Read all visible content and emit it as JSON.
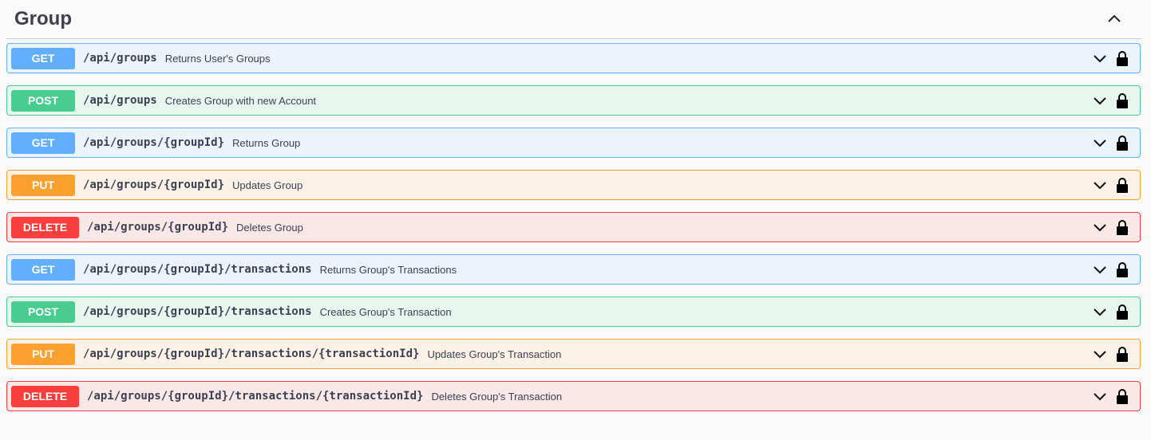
{
  "section": {
    "title": "Group",
    "toggle_icon": "chevron-up-icon"
  },
  "operations": [
    {
      "method": "GET",
      "path": "/api/groups",
      "summary": "Returns User's Groups"
    },
    {
      "method": "POST",
      "path": "/api/groups",
      "summary": "Creates Group with new Account"
    },
    {
      "method": "GET",
      "path": "/api/groups/{groupId}",
      "summary": "Returns Group"
    },
    {
      "method": "PUT",
      "path": "/api/groups/{groupId}",
      "summary": "Updates Group"
    },
    {
      "method": "DELETE",
      "path": "/api/groups/{groupId}",
      "summary": "Deletes Group"
    },
    {
      "method": "GET",
      "path": "/api/groups/{groupId}/transactions",
      "summary": "Returns Group's Transactions"
    },
    {
      "method": "POST",
      "path": "/api/groups/{groupId}/transactions",
      "summary": "Creates Group's Transaction"
    },
    {
      "method": "PUT",
      "path": "/api/groups/{groupId}/transactions/{transactionId}",
      "summary": "Updates Group's Transaction"
    },
    {
      "method": "DELETE",
      "path": "/api/groups/{groupId}/transactions/{transactionId}",
      "summary": "Deletes Group's Transaction"
    }
  ],
  "colors": {
    "get": "#61affe",
    "post": "#49cc90",
    "put": "#fca130",
    "delete": "#f93e3e"
  },
  "icons": {
    "expand": "chevron-down-icon",
    "auth": "lock-icon"
  }
}
